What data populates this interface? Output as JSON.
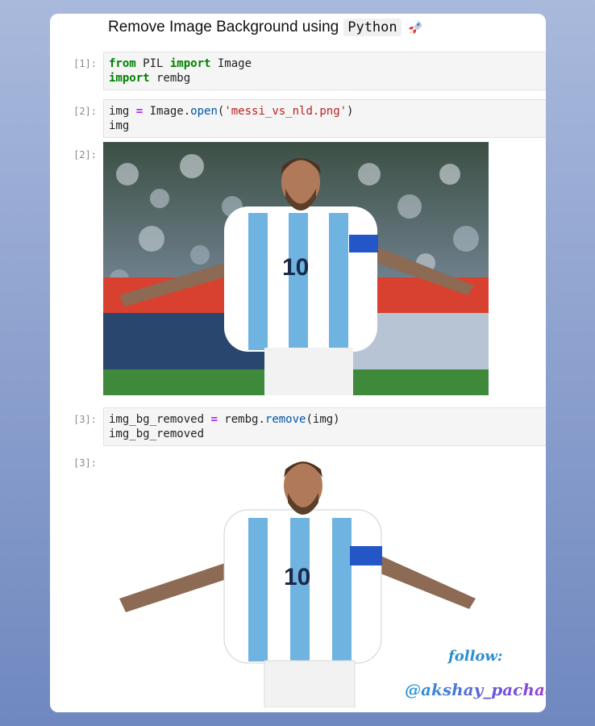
{
  "notebook": {
    "title_prefix": "Remove Image Background using",
    "title_code": "Python",
    "cells": [
      {
        "prompt": "[1]:",
        "tokens": [
          {
            "t": "from",
            "c": "kw"
          },
          {
            "t": " PIL ",
            "c": ""
          },
          {
            "t": "import",
            "c": "kw"
          },
          {
            "t": " Image\n",
            "c": ""
          },
          {
            "t": "import",
            "c": "kw"
          },
          {
            "t": " rembg",
            "c": ""
          }
        ]
      },
      {
        "prompt": "[2]:",
        "tokens": [
          {
            "t": "img ",
            "c": ""
          },
          {
            "t": "=",
            "c": "op"
          },
          {
            "t": " Image.",
            "c": ""
          },
          {
            "t": "open",
            "c": "fn"
          },
          {
            "t": "(",
            "c": ""
          },
          {
            "t": "'messi_vs_nld.png'",
            "c": "str"
          },
          {
            "t": ")\nimg",
            "c": ""
          }
        ]
      },
      {
        "prompt": "[3]:",
        "tokens": [
          {
            "t": "img_bg_removed ",
            "c": ""
          },
          {
            "t": "=",
            "c": "op"
          },
          {
            "t": " rembg.",
            "c": ""
          },
          {
            "t": "remove",
            "c": "fn"
          },
          {
            "t": "(img)\nimg_bg_removed",
            "c": ""
          }
        ]
      }
    ],
    "output_prompts": {
      "out2": "[2]:",
      "out3": "[3]:"
    },
    "jersey_number": "10"
  },
  "watermark": {
    "follow": "follow:",
    "handle": "@akshay_pachaar"
  },
  "colors": {
    "keyword": "#008000",
    "operator": "#aa22ff",
    "function": "#0055aa",
    "string": "#ba2121",
    "accent": "#2a8fd0"
  }
}
